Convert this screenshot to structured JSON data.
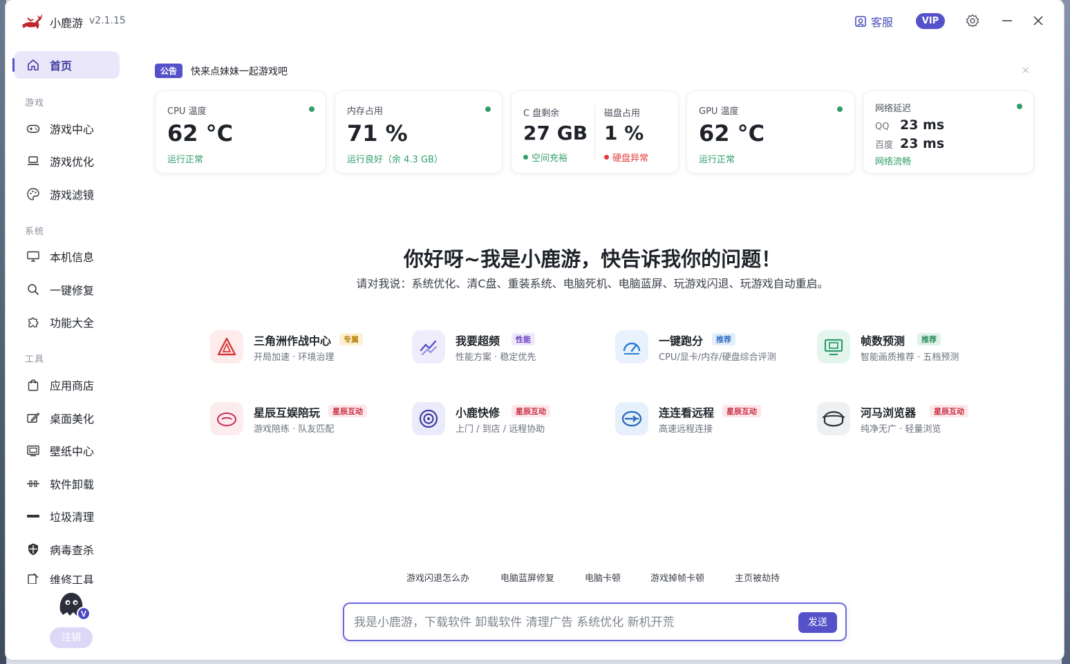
{
  "app": {
    "name": "小鹿游",
    "version": "v2.1.15"
  },
  "titlebar": {
    "support_label": "客服",
    "vip_label": "VIP"
  },
  "sidebar": {
    "home": "首页",
    "section_game": "游戏",
    "game_items": [
      "游戏中心",
      "游戏优化",
      "游戏滤镜"
    ],
    "section_system": "系统",
    "system_items": [
      "本机信息",
      "一键修复",
      "功能大全"
    ],
    "section_tools": "工具",
    "tool_items": [
      "应用商店",
      "桌面美化",
      "壁纸中心",
      "软件卸载",
      "垃圾清理",
      "病毒查杀",
      "维修工具"
    ],
    "logout_label": "注销",
    "avatar_badge": "V"
  },
  "notice": {
    "tag": "公告",
    "text": "快来点妹妹一起游戏吧",
    "close": "×"
  },
  "stats": {
    "cpu": {
      "label": "CPU 温度",
      "value": "62 °C",
      "status": "运行正常"
    },
    "memory": {
      "label": "内存占用",
      "value": "71 %",
      "status": "运行良好（余 4.3 GB）"
    },
    "disk_c": {
      "label": "C 盘剩余",
      "value": "27 GB",
      "status": "空间充裕"
    },
    "disk_usage": {
      "label": "磁盘占用",
      "value": "1 %",
      "status": "硬盘异常"
    },
    "gpu": {
      "label": "GPU 温度",
      "value": "62 °C",
      "status": "运行正常"
    },
    "network": {
      "label": "网络延迟",
      "qq_label": "QQ",
      "qq_value": "23 ms",
      "baidu_label": "百度",
      "baidu_value": "23 ms",
      "status": "网络流畅"
    }
  },
  "hero": {
    "title": "你好呀~我是小鹿游，快告诉我你的问题！",
    "subtitle": "请对我说：系统优化、清C盘、重装系统、电脑死机、电脑蓝屏、玩游戏闪退、玩游戏自动重启。"
  },
  "features": [
    {
      "title": "三角洲作战中心",
      "badge": "专属",
      "desc": "开局加速 · 环境治理"
    },
    {
      "title": "我要超频",
      "badge": "性能",
      "desc": "性能方案 · 稳定优先"
    },
    {
      "title": "一键跑分",
      "badge": "推荐",
      "desc": "CPU/显卡/内存/硬盘综合评测"
    },
    {
      "title": "帧数预测",
      "badge": "推荐",
      "desc": "智能画质推荐 · 五档预测"
    },
    {
      "title": "星辰互娱陪玩",
      "badge": "星辰互动",
      "desc": "游戏陪练 · 队友匹配"
    },
    {
      "title": "小鹿快修",
      "badge": "星辰互动",
      "desc": "上门 / 到店 / 远程协助"
    },
    {
      "title": "连连看远程",
      "badge": "星辰互动",
      "desc": "高速远程连接"
    },
    {
      "title": "河马浏览器",
      "badge": "星辰互动",
      "desc": "纯净无广 · 轻量浏览"
    }
  ],
  "quick_tags": [
    "游戏闪退怎么办",
    "电脑蓝屏修复",
    "电脑卡顿",
    "游戏掉帧卡顿",
    "主页被劫持"
  ],
  "chat": {
    "placeholder": "我是小鹿游，下载软件 卸载软件 清理广告 系统优化 新机开荒",
    "send_label": "发送"
  },
  "colors": {
    "accent": "#5552c9",
    "ok": "#2f9e6b",
    "error": "#e23b3b"
  }
}
